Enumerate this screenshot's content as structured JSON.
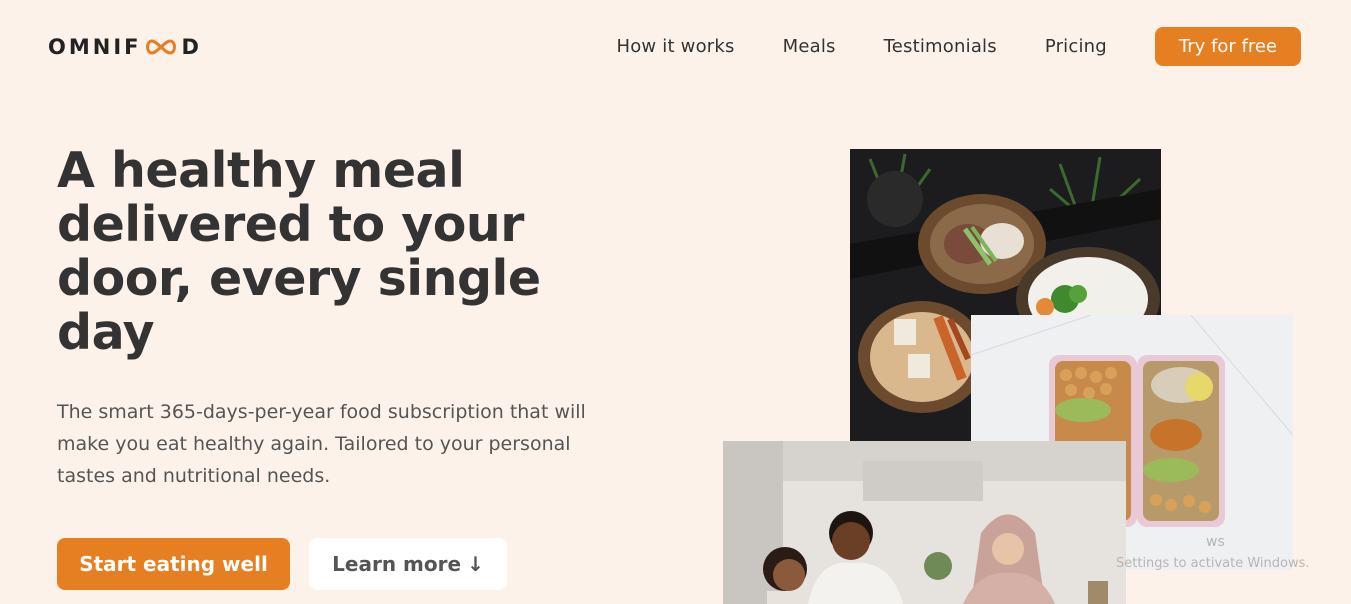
{
  "brand": {
    "logo_text_left": "OMNIF",
    "logo_text_right": "D"
  },
  "nav": {
    "links": [
      "How it works",
      "Meals",
      "Testimonials",
      "Pricing"
    ],
    "cta": "Try for free"
  },
  "hero": {
    "title": "A healthy meal delivered to your door, every single day",
    "description": "The smart 365-days-per-year food subscription that will make you eat healthy again. Tailored to your personal tastes and nutritional needs.",
    "primary_button": "Start eating well",
    "secondary_button": "Learn more",
    "secondary_arrow": "↓"
  },
  "watermark": {
    "line1": "ws",
    "line2": "Settings to activate Windows."
  },
  "colors": {
    "accent": "#e67e22",
    "background": "#fdf2e9",
    "text": "#333333"
  }
}
